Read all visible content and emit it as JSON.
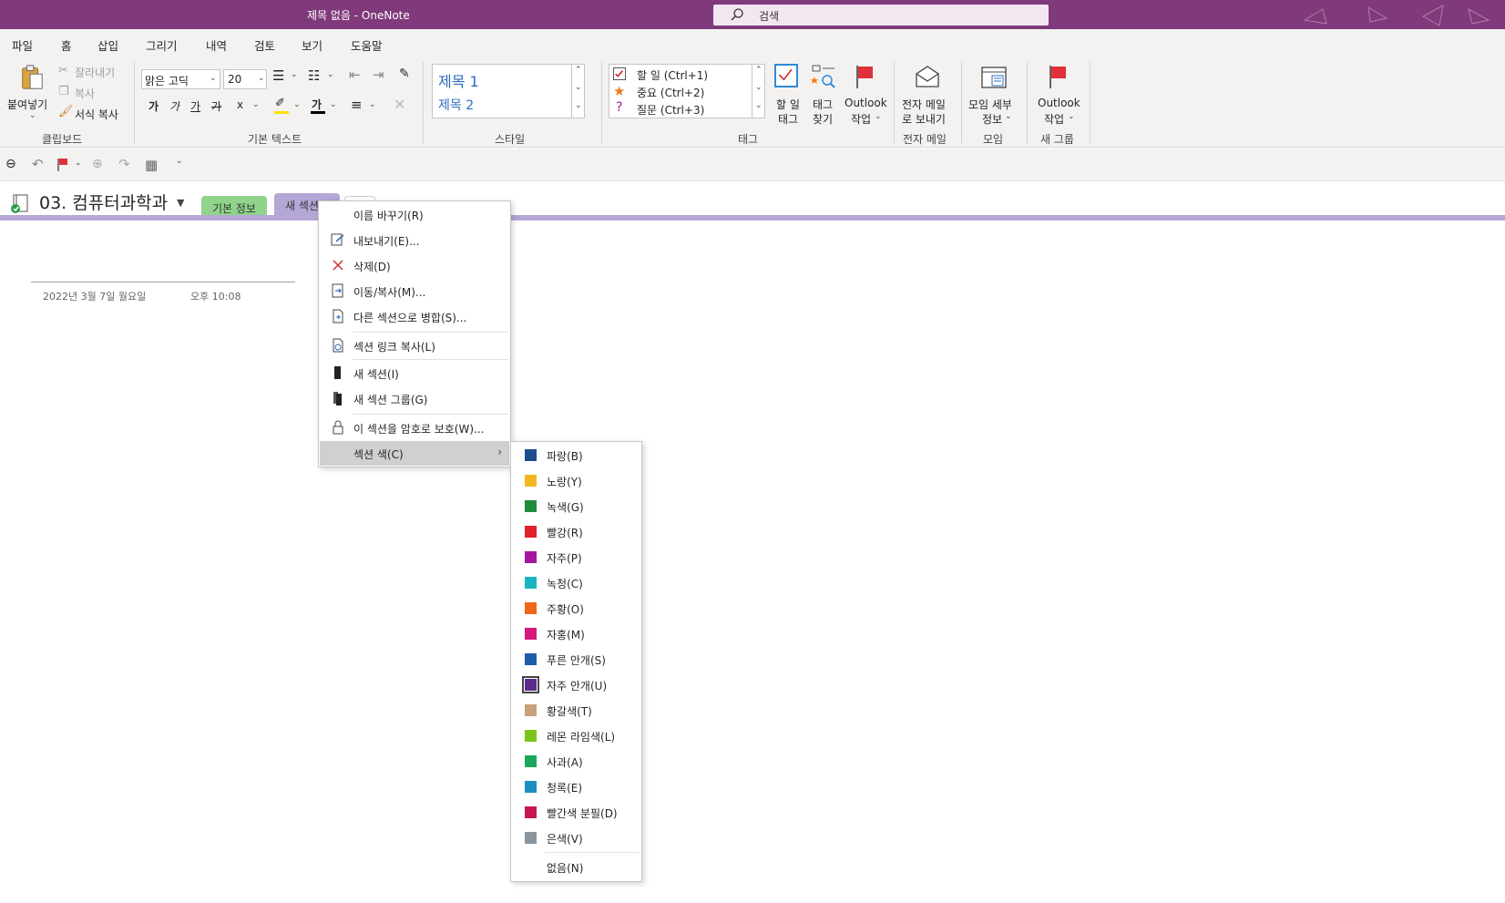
{
  "titlebar": {
    "title": "제목 없음  -  OneNote",
    "search_placeholder": "검색"
  },
  "ribbon_tabs": [
    {
      "label": "파일"
    },
    {
      "label": "홈"
    },
    {
      "label": "삽입"
    },
    {
      "label": "그리기"
    },
    {
      "label": "내역"
    },
    {
      "label": "검토"
    },
    {
      "label": "보기"
    },
    {
      "label": "도움말"
    }
  ],
  "ribbon": {
    "clipboard": {
      "paste": "붙여넣기",
      "cut": "잘라내기",
      "copy": "복사",
      "format_painter": "서식 복사",
      "group": "클립보드"
    },
    "basic_text": {
      "font": "맑은 고딕",
      "size": "20",
      "group": "기본 텍스트",
      "fmt1": "가",
      "fmt2": "가",
      "fmt3": "가",
      "fmt4": "가",
      "sub": "x",
      "fontcolor": "가"
    },
    "styles": {
      "h1": "제목 1",
      "h2": "제목 2",
      "group": "스타일"
    },
    "tags": {
      "todo": "할 일 (Ctrl+1)",
      "important": "중요 (Ctrl+2)",
      "question": "질문 (Ctrl+3)",
      "todo_tag_1": "할 일",
      "todo_tag_2": "태그",
      "find_1": "태그",
      "find_2": "찾기",
      "outlook_1": "Outlook",
      "outlook_2": "작업",
      "group": "태그"
    },
    "email": {
      "l1": "전자 메일",
      "l2": "로 보내기",
      "group": "전자 메일"
    },
    "meeting": {
      "l1": "모임 세부",
      "l2": "정보",
      "group": "모임"
    },
    "newgroup": {
      "l1": "Outlook",
      "l2": "작업",
      "group": "새 그룹"
    }
  },
  "notebook": {
    "name": "03. 컴퓨터과학과"
  },
  "sections": [
    {
      "label": "기본 정보"
    },
    {
      "label": "새 섹션"
    }
  ],
  "page": {
    "date": "2022년 3월 7일 월요일",
    "time": "오후 10:08"
  },
  "context_menu": {
    "items": [
      {
        "label": "이름 바꾸기(R)",
        "icon": "none"
      },
      {
        "label": "내보내기(E)...",
        "icon": "export-icon"
      },
      {
        "label": "삭제(D)",
        "icon": "delete-icon"
      },
      {
        "label": "이동/복사(M)...",
        "icon": "move-icon"
      },
      {
        "label": "다른 섹션으로 병합(S)...",
        "icon": "merge-icon"
      },
      {
        "label": "섹션 링크 복사(L)",
        "icon": "link-icon"
      },
      {
        "label": "새 섹션(I)",
        "icon": "new-section-icon"
      },
      {
        "label": "새 섹션 그룹(G)",
        "icon": "section-group-icon"
      },
      {
        "label": "이 섹션을 암호로 보호(W)...",
        "icon": "lock-icon"
      },
      {
        "label": "섹션 색(C)",
        "icon": "none"
      }
    ]
  },
  "color_menu": {
    "items": [
      {
        "label": "파랑(B)",
        "color": "#1f4e8c"
      },
      {
        "label": "노랑(Y)",
        "color": "#f2b71f"
      },
      {
        "label": "녹색(G)",
        "color": "#1e8c3a"
      },
      {
        "label": "빨강(R)",
        "color": "#e0202a"
      },
      {
        "label": "자주(P)",
        "color": "#a5179c"
      },
      {
        "label": "녹청(C)",
        "color": "#17b5c0"
      },
      {
        "label": "주황(O)",
        "color": "#f0671a"
      },
      {
        "label": "자홍(M)",
        "color": "#d6197c"
      },
      {
        "label": "푸른 안개(S)",
        "color": "#1a5fa8"
      },
      {
        "label": "자주 안개(U)",
        "color": "#5b2c8e"
      },
      {
        "label": "황갈색(T)",
        "color": "#c8a07a"
      },
      {
        "label": "레몬 라임색(L)",
        "color": "#7cc41a"
      },
      {
        "label": "사과(A)",
        "color": "#1aa85a"
      },
      {
        "label": "청록(E)",
        "color": "#1a8fc0"
      },
      {
        "label": "빨간색 분필(D)",
        "color": "#c8174e"
      },
      {
        "label": "은색(V)",
        "color": "#8a959e"
      },
      {
        "label": "없음(N)",
        "color": ""
      }
    ]
  }
}
